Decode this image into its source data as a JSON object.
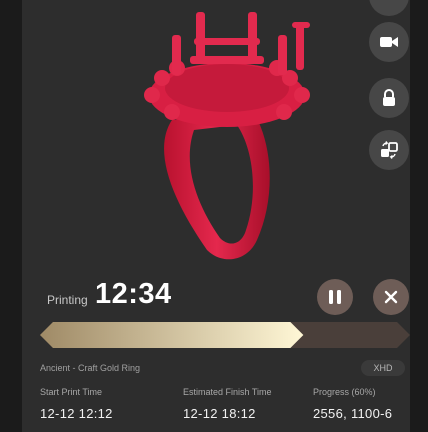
{
  "job": {
    "status_label": "Printing",
    "time": "12:34",
    "model_name": "Ancient - Craft Gold Ring",
    "badge": "XHD"
  },
  "progress": {
    "fraction": 0.69
  },
  "info": {
    "start_label": "Start Print Time",
    "start_value": "12-12 12:12",
    "finish_label": "Estimated Finish Time",
    "finish_value": "12-12 18:12",
    "progress_label": "Progress  (60%)",
    "progress_value": "2556,  1100-6"
  },
  "colors": {
    "background": "#2d2d2d",
    "model": "#d81f43",
    "button": "#6e5d57",
    "side_button": "#474747",
    "progress_fill_start": "#9f8a66",
    "progress_fill_end": "#fff7d6",
    "progress_track": "#4a3f3a"
  },
  "icons": {
    "top": "circle-button-icon",
    "video": "video-camera-icon",
    "lock": "lock-icon",
    "swap": "swap-icon",
    "pause": "pause-icon",
    "close": "close-icon"
  }
}
